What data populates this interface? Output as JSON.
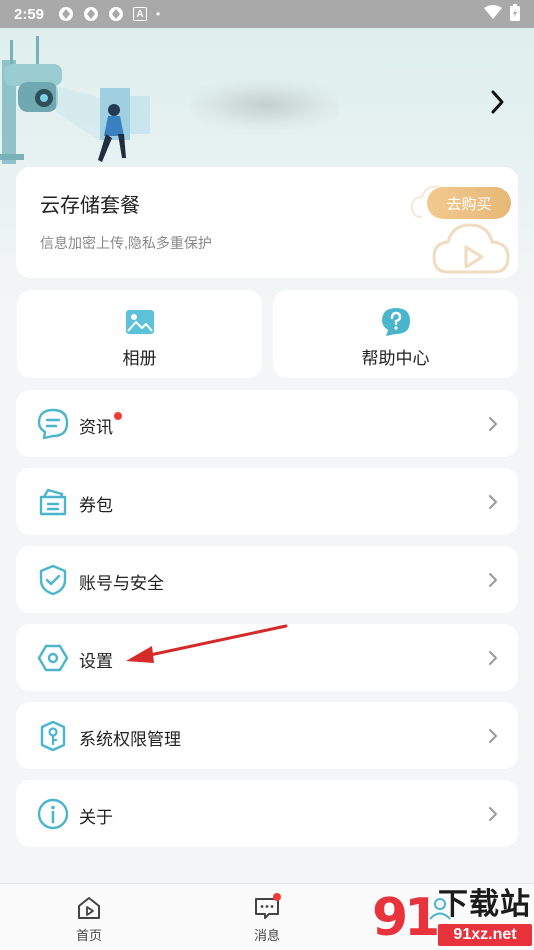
{
  "status_bar": {
    "time": "2:59",
    "letter_icon": "A",
    "dot": "•"
  },
  "cloud": {
    "title": "云存储套餐",
    "subtitle": "信息加密上传,隐私多重保护",
    "buy_label": "去购买"
  },
  "quick_actions": [
    {
      "label": "相册",
      "icon": "photo-album-icon"
    },
    {
      "label": "帮助中心",
      "icon": "help-question-icon"
    }
  ],
  "menu": [
    {
      "label": "资讯",
      "icon": "chat-bubble-icon",
      "badge": true
    },
    {
      "label": "券包",
      "icon": "wallet-coupon-icon",
      "badge": false
    },
    {
      "label": "账号与安全",
      "icon": "shield-check-icon",
      "badge": false
    },
    {
      "label": "设置",
      "icon": "hexagon-settings-icon",
      "badge": false
    },
    {
      "label": "系统权限管理",
      "icon": "key-permission-icon",
      "badge": false
    },
    {
      "label": "关于",
      "icon": "info-icon",
      "badge": false
    }
  ],
  "bottom_nav": {
    "home": "首页",
    "messages": "消息"
  },
  "watermark": {
    "number": "91",
    "title": "下载站",
    "url": "91xz.net"
  },
  "colors": {
    "accent": "#4ab5cc",
    "buy_button": "#e6b877",
    "badge": "#f23c3c",
    "annotation_arrow": "#d42a2a"
  }
}
